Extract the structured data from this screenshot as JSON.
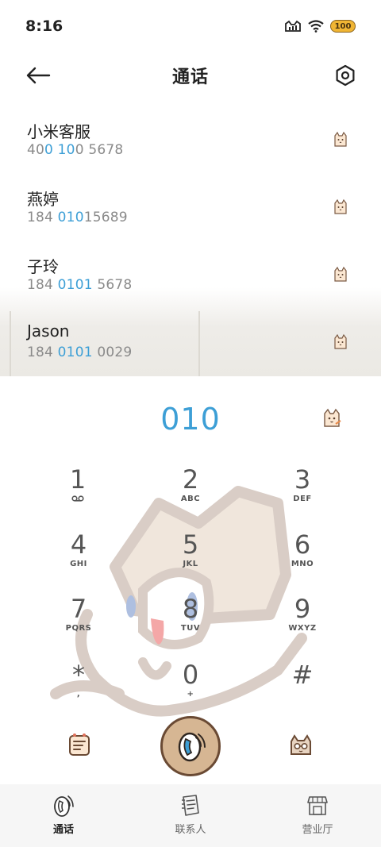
{
  "status_bar": {
    "time": "8:16",
    "battery": "100"
  },
  "header": {
    "title": "通话"
  },
  "results": [
    {
      "name": "小米客服",
      "number_parts": [
        "40",
        "0 10",
        "0 5678"
      ]
    },
    {
      "name": "燕婷",
      "number_parts": [
        "184 ",
        "010",
        "15689"
      ]
    },
    {
      "name": "子玲",
      "number_parts": [
        "184 ",
        "0101",
        " 5678"
      ]
    },
    {
      "name": "Jason",
      "number_parts": [
        "184 ",
        "0101",
        " 0029"
      ]
    }
  ],
  "dialer": {
    "number": "010",
    "keys": [
      {
        "digit": "1",
        "letters": ""
      },
      {
        "digit": "2",
        "letters": "ABC"
      },
      {
        "digit": "3",
        "letters": "DEF"
      },
      {
        "digit": "4",
        "letters": "GHI"
      },
      {
        "digit": "5",
        "letters": "JKL"
      },
      {
        "digit": "6",
        "letters": "MNO"
      },
      {
        "digit": "7",
        "letters": "PQRS"
      },
      {
        "digit": "8",
        "letters": "TUV"
      },
      {
        "digit": "9",
        "letters": "WXYZ"
      },
      {
        "digit": "*",
        "letters": ","
      },
      {
        "digit": "0",
        "letters": "+"
      },
      {
        "digit": "#",
        "letters": ""
      }
    ]
  },
  "bottom_nav": [
    {
      "label": "通话",
      "icon": "phone-cat-icon",
      "active": true
    },
    {
      "label": "联系人",
      "icon": "contacts-book-icon",
      "active": false
    },
    {
      "label": "营业厅",
      "icon": "store-icon",
      "active": false
    }
  ],
  "colors": {
    "accent": "#3d9fd6",
    "call_button": "#d6b693",
    "outline": "#6a4a34"
  }
}
